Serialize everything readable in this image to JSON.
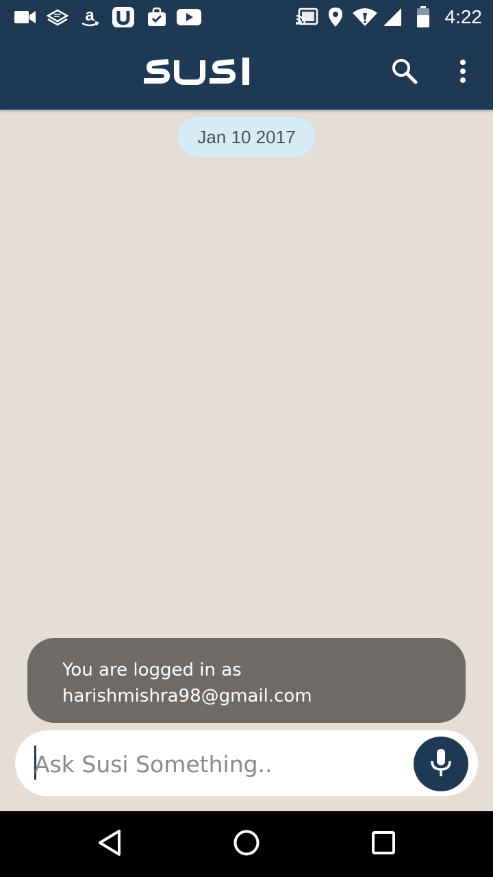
{
  "status_bar": {
    "time": "4:22",
    "left_icons": [
      "video-camera-icon",
      "stack-icon",
      "amazon-icon",
      "u-app-icon",
      "shopping-bag-icon",
      "youtube-icon"
    ],
    "right_icons": [
      "cast-icon",
      "location-icon",
      "wifi-icon",
      "signal-icon",
      "battery-icon"
    ]
  },
  "app_bar": {
    "logo_text": "SUSI",
    "actions": [
      "search-icon",
      "more-vert-icon"
    ],
    "background": "#1f3954"
  },
  "chat": {
    "date_label": "Jan 10 2017"
  },
  "toast": {
    "line1": "You are logged in as",
    "line2": "harishmishra98@gmail.com"
  },
  "input": {
    "placeholder": "Ask Susi Something..",
    "value": ""
  },
  "nav_bar": {
    "buttons": [
      "back-icon",
      "home-icon",
      "recents-icon"
    ]
  }
}
